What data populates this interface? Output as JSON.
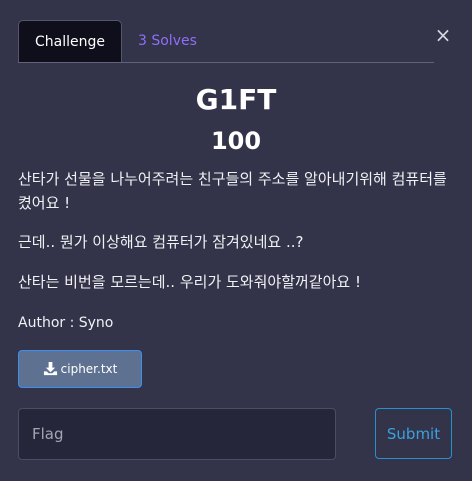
{
  "tabs": {
    "challenge": "Challenge",
    "solves": "3 Solves"
  },
  "close_label": "×",
  "challenge": {
    "name": "G1FT",
    "value": "100",
    "description": [
      "산타가 선물을 나누어주려는 친구들의 주소를 알아내기위해 컴퓨터를 켰어요 !",
      "근데.. 뭔가 이상해요 컴퓨터가 잠겨있네요 ..?",
      "산타는 비번을 모르는데.. 우리가 도와줘야할꺼같아요 !"
    ],
    "author": "Author : Syno",
    "file": {
      "label": "cipher.txt",
      "icon": "download-icon"
    }
  },
  "form": {
    "flag_placeholder": "Flag",
    "flag_value": "",
    "submit_label": "Submit"
  },
  "colors": {
    "background": "#33334a",
    "tab_active_bg": "#0f0f1b",
    "tab_link": "#8d70f5",
    "file_button_bg": "#5e7191",
    "file_button_border": "#3b8ff0",
    "submit_border": "#2591cf"
  }
}
